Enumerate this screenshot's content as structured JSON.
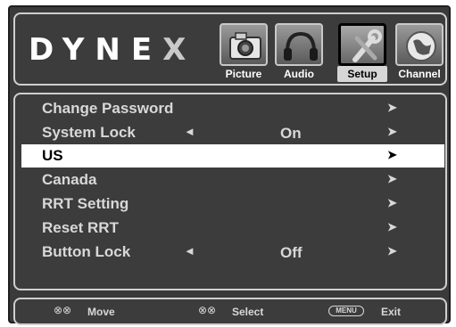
{
  "brand": {
    "logo_main": "DYNE",
    "logo_last": "X"
  },
  "tabs": [
    {
      "label": "Picture",
      "icon": "camera-icon",
      "selected": false
    },
    {
      "label": "Audio",
      "icon": "headphones-icon",
      "selected": false
    },
    {
      "label": "Setup",
      "icon": "tools-icon",
      "selected": true
    },
    {
      "label": "Channel",
      "icon": "globe-icon",
      "selected": false
    }
  ],
  "menu": {
    "items": [
      {
        "label": "Change Password",
        "value": "",
        "left_arrow": "",
        "right_arrow": "➤"
      },
      {
        "label": "System Lock",
        "value": "On",
        "left_arrow": "◄",
        "right_arrow": "➤"
      },
      {
        "label": "US",
        "value": "",
        "left_arrow": "",
        "right_arrow": "➤",
        "selected": true
      },
      {
        "label": "Canada",
        "value": "",
        "left_arrow": "",
        "right_arrow": "➤"
      },
      {
        "label": "RRT Setting",
        "value": "",
        "left_arrow": "",
        "right_arrow": "➤"
      },
      {
        "label": "Reset RRT",
        "value": "",
        "left_arrow": "",
        "right_arrow": "➤"
      },
      {
        "label": "Button Lock",
        "value": "Off",
        "left_arrow": "◄",
        "right_arrow": "➤"
      }
    ]
  },
  "footer": {
    "move_glyph": "⊗⊗",
    "move_label": "Move",
    "select_glyph": "⊗⊗",
    "select_label": "Select",
    "menu_key": "MENU",
    "exit_label": "Exit"
  },
  "colors": {
    "background": "#3c3c3c",
    "border": "#cfcfcf",
    "highlight": "#ffffff",
    "text": "#d8d8d8"
  }
}
